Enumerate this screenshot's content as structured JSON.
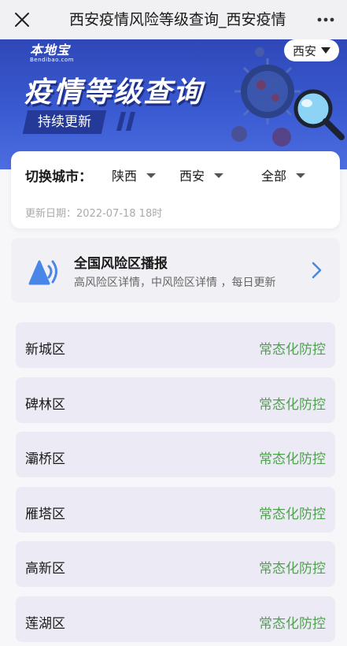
{
  "topbar": {
    "title": "西安疫情风险等级查询_西安疫情"
  },
  "banner": {
    "logo_main": "本地宝",
    "logo_sub": "Bendibao.com",
    "heading": "疫情等级查询",
    "tag": "持续更新",
    "city": "西安"
  },
  "switcher": {
    "label": "切换城市：",
    "province": "陕西",
    "city": "西安",
    "district": "全部",
    "update_text": "更新日期：2022-07-18 18时"
  },
  "broadcast": {
    "title": "全国风险区播报",
    "subtitle": "高风险区详情，中风险区详情 ，每日更新"
  },
  "districts": [
    {
      "name": "新城区",
      "status": "常态化防控"
    },
    {
      "name": "碑林区",
      "status": "常态化防控"
    },
    {
      "name": "灞桥区",
      "status": "常态化防控"
    },
    {
      "name": "雁塔区",
      "status": "常态化防控"
    },
    {
      "name": "高新区",
      "status": "常态化防控"
    },
    {
      "name": "莲湖区",
      "status": "常态化防控"
    }
  ],
  "colors": {
    "banner_blue": "#3a5ad2",
    "status_green": "#4ea24e",
    "icon_blue": "#4a86e8"
  }
}
